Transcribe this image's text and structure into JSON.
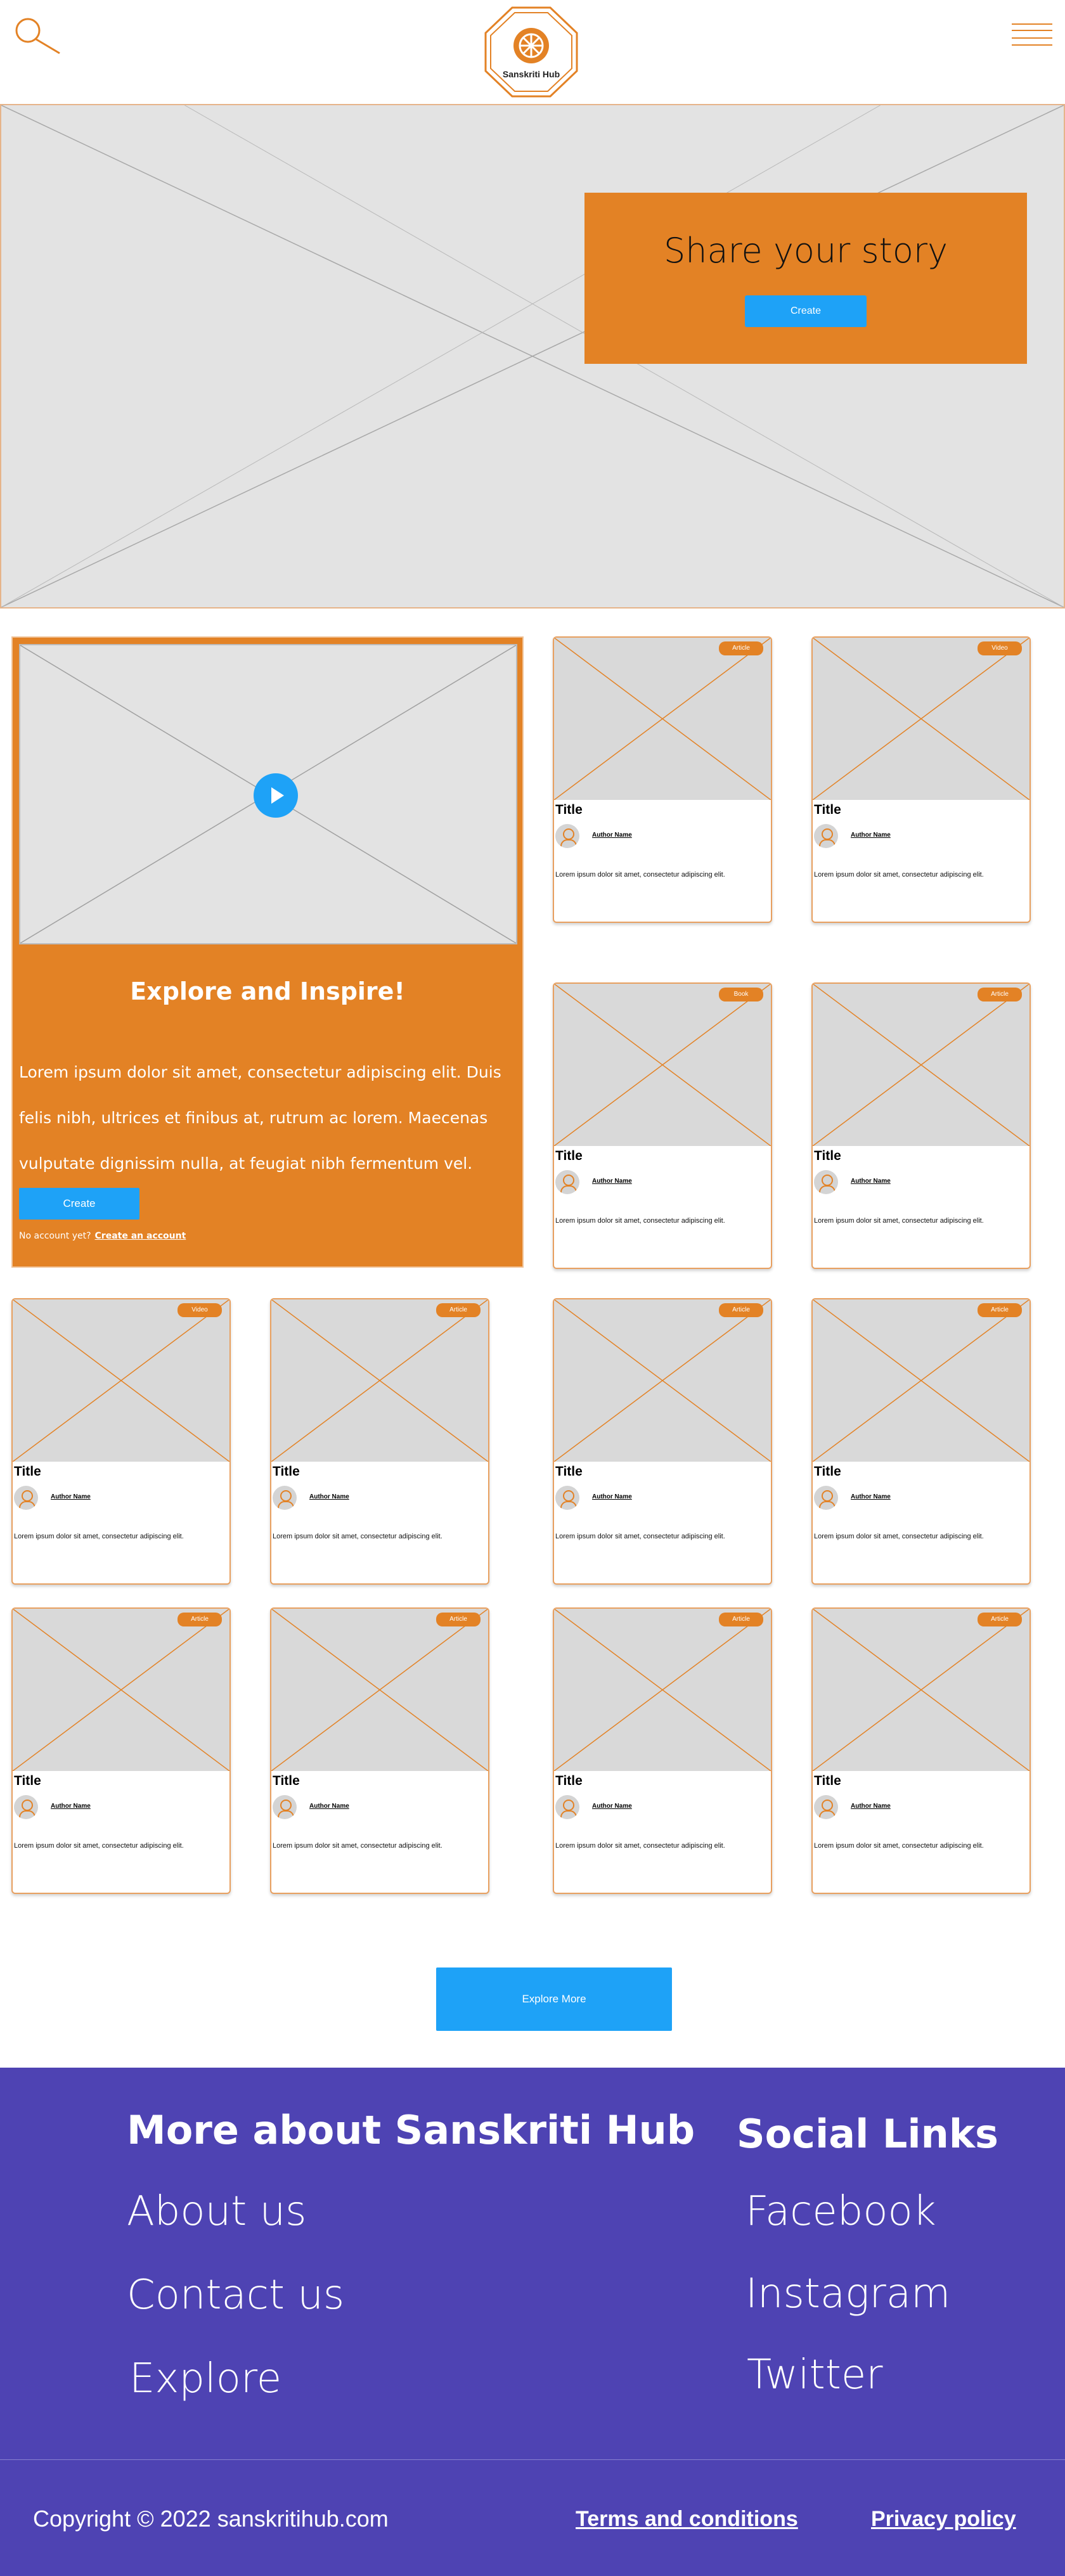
{
  "header": {
    "logo_text": "Sanskriti Hub",
    "search_icon": "search-icon",
    "menu_icon": "hamburger-menu-icon"
  },
  "hero": {
    "title": "Share your story",
    "button_label": "Create"
  },
  "feature": {
    "title": "Explore and Inspire!",
    "text": "Lorem ipsum dolor sit amet, consectetur adipiscing elit. Duis felis nibh, ultrices et finibus at, rutrum ac lorem. Maecenas vulputate dignissim nulla, at feugiat nibh fermentum vel.",
    "button_label": "Create",
    "no_account_text": "No account yet?",
    "create_account_link": "Create an account"
  },
  "cards": [
    {
      "tag": "Article",
      "title": "Title",
      "author": "Author Name",
      "desc": "Lorem ipsum dolor sit amet, consectetur adipiscing elit."
    },
    {
      "tag": "Video",
      "title": "Title",
      "author": "Author Name",
      "desc": "Lorem ipsum dolor sit amet, consectetur adipiscing elit."
    },
    {
      "tag": "Book",
      "title": "Title",
      "author": "Author Name",
      "desc": "Lorem ipsum dolor sit amet, consectetur adipiscing elit."
    },
    {
      "tag": "Article",
      "title": "Title",
      "author": "Author Name",
      "desc": "Lorem ipsum dolor sit amet, consectetur adipiscing elit."
    },
    {
      "tag": "Video",
      "title": "Title",
      "author": "Author Name",
      "desc": "Lorem ipsum dolor sit amet, consectetur adipiscing elit."
    },
    {
      "tag": "Article",
      "title": "Title",
      "author": "Author Name",
      "desc": "Lorem ipsum dolor sit amet, consectetur adipiscing elit."
    },
    {
      "tag": "Article",
      "title": "Title",
      "author": "Author Name",
      "desc": "Lorem ipsum dolor sit amet, consectetur adipiscing elit."
    },
    {
      "tag": "Article",
      "title": "Title",
      "author": "Author Name",
      "desc": "Lorem ipsum dolor sit amet, consectetur adipiscing elit."
    },
    {
      "tag": "Article",
      "title": "Title",
      "author": "Author Name",
      "desc": "Lorem ipsum dolor sit amet, consectetur adipiscing elit."
    },
    {
      "tag": "Article",
      "title": "Title",
      "author": "Author Name",
      "desc": "Lorem ipsum dolor sit amet, consectetur adipiscing elit."
    },
    {
      "tag": "Article",
      "title": "Title",
      "author": "Author Name",
      "desc": "Lorem ipsum dolor sit amet, consectetur adipiscing elit."
    },
    {
      "tag": "Article",
      "title": "Title",
      "author": "Author Name",
      "desc": "Lorem ipsum dolor sit amet, consectetur adipiscing elit."
    }
  ],
  "explore_more_label": "Explore More",
  "footer": {
    "more_heading": "More about Sanskriti Hub",
    "links": [
      "About us",
      "Contact us",
      "Explore"
    ],
    "social_heading": "Social Links",
    "social": [
      "Facebook",
      "Instagram",
      "Twitter"
    ],
    "copyright": "Copyright © 2022 sanskritihub.com",
    "terms": "Terms and conditions",
    "privacy": "Privacy policy"
  },
  "colors": {
    "accent_orange": "#e38225",
    "button_blue": "#1ea2f7",
    "footer_purple": "#4e43b3"
  }
}
